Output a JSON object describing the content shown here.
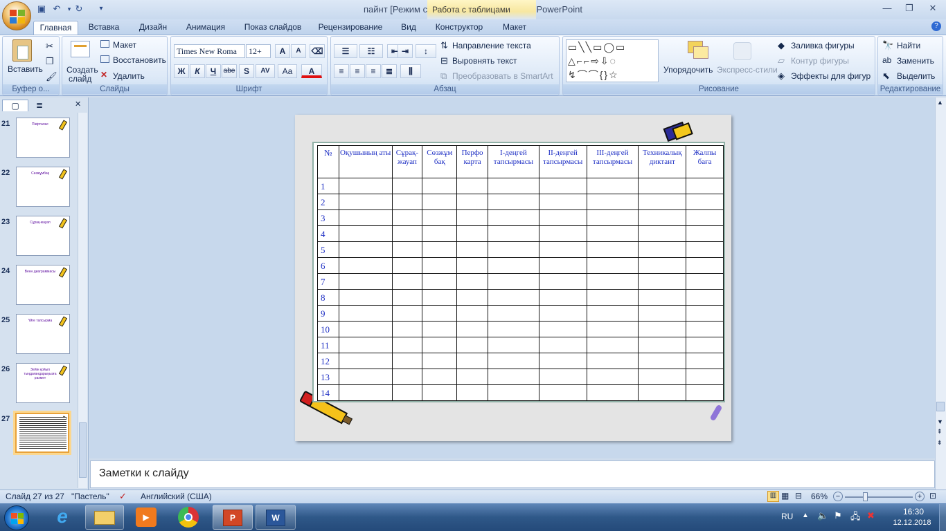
{
  "window": {
    "title": "пайнт [Режим совместимости] - Microsoft PowerPoint",
    "context_tab_group": "Работа с таблицами"
  },
  "tabs": [
    "Главная",
    "Вставка",
    "Дизайн",
    "Анимация",
    "Показ слайдов",
    "Рецензирование",
    "Вид",
    "Конструктор",
    "Макет"
  ],
  "ribbon": {
    "clipboard": {
      "paste": "Вставить",
      "label": "Буфер о..."
    },
    "slides": {
      "new_slide": "Создать",
      "new_slide2": "слайд",
      "layout": "Макет",
      "reset": "Восстановить",
      "delete": "Удалить",
      "label": "Слайды"
    },
    "font": {
      "name": "Times New Roma",
      "size": "12+",
      "bold": "Ж",
      "italic": "К",
      "underline": "Ч",
      "strike": "abe",
      "shadow": "S",
      "spacing": "AV",
      "case": "Aa",
      "color": "A",
      "grow": "A",
      "shrink": "A",
      "label": "Шрифт"
    },
    "paragraph": {
      "text_direction": "Направление текста",
      "align_text": "Выровнять текст",
      "smartart": "Преобразовать в SmartArt",
      "label": "Абзац"
    },
    "drawing": {
      "arrange": "Упорядочить",
      "quick_styles": "Экспресс-стили",
      "fill": "Заливка фигуры",
      "outline": "Контур фигуры",
      "effects": "Эффекты для фигур",
      "label": "Рисование"
    },
    "editing": {
      "find": "Найти",
      "replace": "Заменить",
      "select": "Выделить",
      "label": "Редактирование"
    }
  },
  "slides": [
    {
      "num": "21",
      "title": "Пікірталас"
    },
    {
      "num": "22",
      "title": "Сөзжұмбақ"
    },
    {
      "num": "23",
      "title": "Сұрақ-жауап"
    },
    {
      "num": "24",
      "title": "Венн диаграммасы"
    },
    {
      "num": "25",
      "title": "Үйге тапсырма"
    },
    {
      "num": "26",
      "title": "Зейін қойып тыңдағандарыңызға рахмет"
    },
    {
      "num": "27",
      "title": ""
    }
  ],
  "table": {
    "headers": [
      "№",
      "Оқушының аты",
      "Сұрақ-жауап",
      "Сөзжұм бақ",
      "Перфо карта",
      "І-деңгей тапсырмасы",
      "ІІ-деңгей тапсырмасы",
      "ІІІ-деңгей тапсырмасы",
      "Техникалық диктант",
      "Жалпы баға"
    ],
    "rows": [
      "1",
      "2",
      "3",
      "4",
      "5",
      "6",
      "7",
      "8",
      "9",
      "10",
      "11",
      "12",
      "13",
      "14"
    ]
  },
  "notes_placeholder": "Заметки к слайду",
  "status": {
    "slide": "Слайд 27 из 27",
    "theme": "\"Пастель\"",
    "language": "Английский (США)",
    "zoom": "66%"
  },
  "taskbar": {
    "lang": "RU",
    "time": "16:30",
    "date": "12.12.2018"
  },
  "colors": {
    "ribbon": "#dde9f7",
    "accent": "#f7e7a0",
    "table_text": "#1e2fc4"
  }
}
